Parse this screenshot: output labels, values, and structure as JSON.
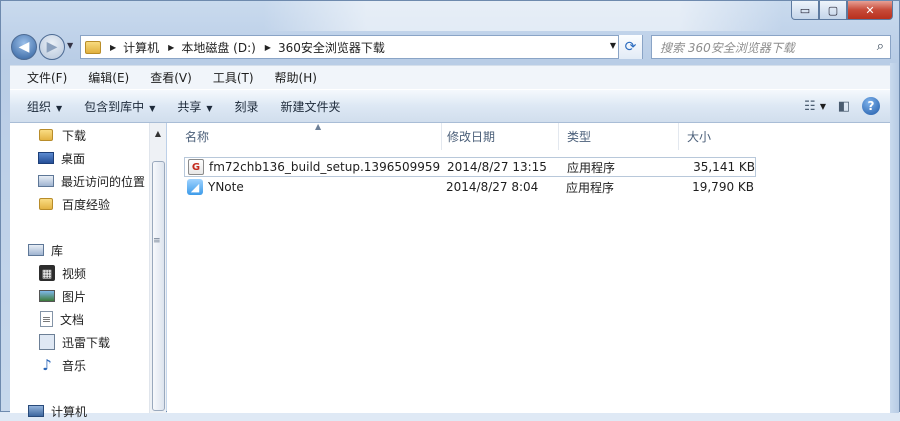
{
  "window": {
    "controls": {
      "minimize": "▭",
      "maximize": "▢",
      "close": "✕"
    }
  },
  "nav": {
    "back_icon": "◀",
    "forward_icon": "▶",
    "history_drop": "▼"
  },
  "address": {
    "crumbs": [
      "计算机",
      "本地磁盘 (D:)",
      "360安全浏览器下载"
    ],
    "separator": "▶",
    "drop": "▼",
    "refresh_icon": "⟳"
  },
  "search": {
    "placeholder": "搜索 360安全浏览器下载",
    "icon": "⌕"
  },
  "menu": [
    "文件(F)",
    "编辑(E)",
    "查看(V)",
    "工具(T)",
    "帮助(H)"
  ],
  "toolbar": {
    "organize": "组织",
    "include_library": "包含到库中",
    "share": "共享",
    "burn": "刻录",
    "new_folder": "新建文件夹",
    "caret": "▼",
    "view_icon": "☷",
    "view_caret": "▼",
    "preview_icon": "◧",
    "help_icon": "?"
  },
  "sidebar": {
    "items": [
      {
        "label": "下载",
        "icon": "folder-icon"
      },
      {
        "label": "桌面",
        "icon": "desktop-icon"
      },
      {
        "label": "最近访问的位置",
        "icon": "recent-places-icon"
      },
      {
        "label": "百度经验",
        "icon": "folder-icon"
      }
    ],
    "library": {
      "label": "库",
      "items": [
        {
          "label": "视频",
          "icon": "video-icon"
        },
        {
          "label": "图片",
          "icon": "pictures-icon"
        },
        {
          "label": "文档",
          "icon": "documents-icon"
        },
        {
          "label": "迅雷下载",
          "icon": "thunder-icon"
        },
        {
          "label": "音乐",
          "icon": "music-icon"
        }
      ]
    },
    "computer": {
      "label": "计算机",
      "icon": "computer-icon"
    },
    "scroll_up": "▲",
    "scroll_grip": "≡"
  },
  "columns": {
    "name": "名称",
    "modified": "修改日期",
    "type": "类型",
    "size": "大小",
    "sort_indicator": "▲"
  },
  "files": [
    {
      "name": "fm72chb136_build_setup.1396509959",
      "modified": "2014/8/27 13:15",
      "type": "应用程序",
      "size": "35,141 KB",
      "icon_glyph": "G",
      "selected": true
    },
    {
      "name": "YNote",
      "modified": "2014/8/27 8:04",
      "type": "应用程序",
      "size": "19,790 KB",
      "icon_glyph": "◢",
      "selected": false
    }
  ]
}
